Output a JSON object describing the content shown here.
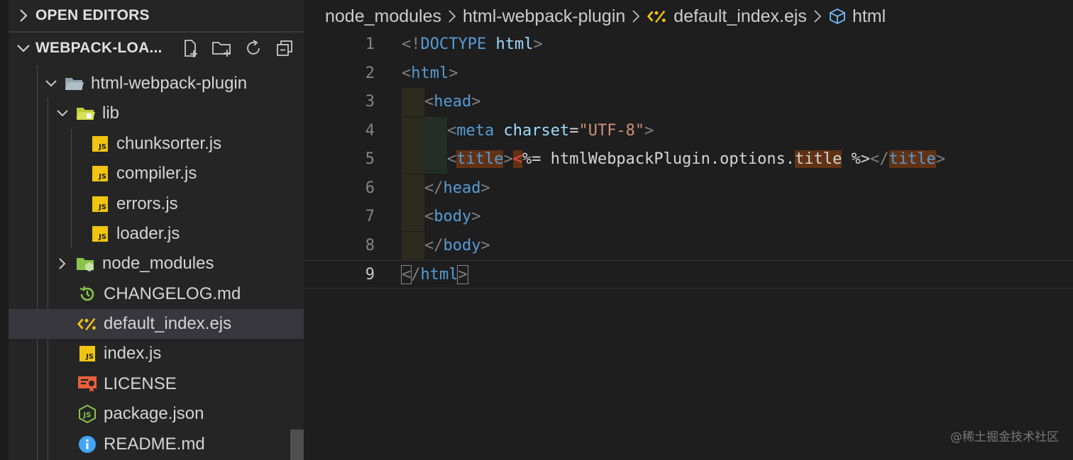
{
  "explorer": {
    "open_editors_label": "OPEN EDITORS",
    "workspace_label": "WEBPACK-LOA...",
    "actions": [
      {
        "icon": "new-file-icon"
      },
      {
        "icon": "new-folder-icon"
      },
      {
        "icon": "refresh-icon"
      },
      {
        "icon": "collapse-all-icon"
      }
    ],
    "tree": {
      "html_webpack_plugin": "html-webpack-plugin",
      "lib": "lib",
      "chunksorter": "chunksorter.js",
      "compiler": "compiler.js",
      "errors": "errors.js",
      "loader": "loader.js",
      "node_modules": "node_modules",
      "changelog": "CHANGELOG.md",
      "default_index": "default_index.ejs",
      "index": "index.js",
      "license": "LICENSE",
      "package": "package.json",
      "readme": "README.md"
    },
    "js_badge": "JS"
  },
  "breadcrumb": {
    "items": [
      "node_modules",
      "html-webpack-plugin",
      "default_index.ejs",
      "html"
    ]
  },
  "editor": {
    "line_numbers": [
      "1",
      "2",
      "3",
      "4",
      "5",
      "6",
      "7",
      "8",
      "9"
    ],
    "lines": {
      "l1": {
        "open": "<!",
        "doctype": "DOCTYPE",
        "space": " ",
        "html": "html",
        "close": ">"
      },
      "l2": {
        "open": "<",
        "tag": "html",
        "close": ">"
      },
      "l3": {
        "open": "<",
        "tag": "head",
        "close": ">"
      },
      "l4": {
        "open": "<",
        "tag": "meta",
        "space": " ",
        "attr": "charset",
        "eq": "=",
        "val": "\"UTF-8\"",
        "close": ">"
      },
      "l5": {
        "open": "<",
        "tag": "title",
        "close": ">",
        "ejs_open": "<",
        "ejs_rest": "%= htmlWebpackPlugin.options.",
        "prop": "title",
        "ejs_close": " %>",
        "end_open": "</",
        "end_tag": "title",
        "end_close": ">"
      },
      "l6": {
        "open": "</",
        "tag": "head",
        "close": ">"
      },
      "l7": {
        "open": "<",
        "tag": "body",
        "close": ">"
      },
      "l8": {
        "open": "</",
        "tag": "body",
        "close": ">"
      },
      "l9": {
        "open": "<",
        "slash": "/",
        "tag": "html",
        "close": ">"
      }
    }
  },
  "watermark": "@稀土掘金技术社区",
  "colors": {
    "tag": "#569cd6",
    "attr": "#9cdcfe",
    "string": "#ce9178",
    "punct": "#808080",
    "js_icon": "#f1c40f",
    "ejs_icon": "#f1c40f",
    "license_icon": "#e8603c",
    "package_icon": "#8bc34a",
    "readme_icon": "#42a5f5",
    "changelog_icon": "#8bc34a",
    "folder_lib": "#c0ca33",
    "folder_node_modules": "#8bc34a"
  }
}
